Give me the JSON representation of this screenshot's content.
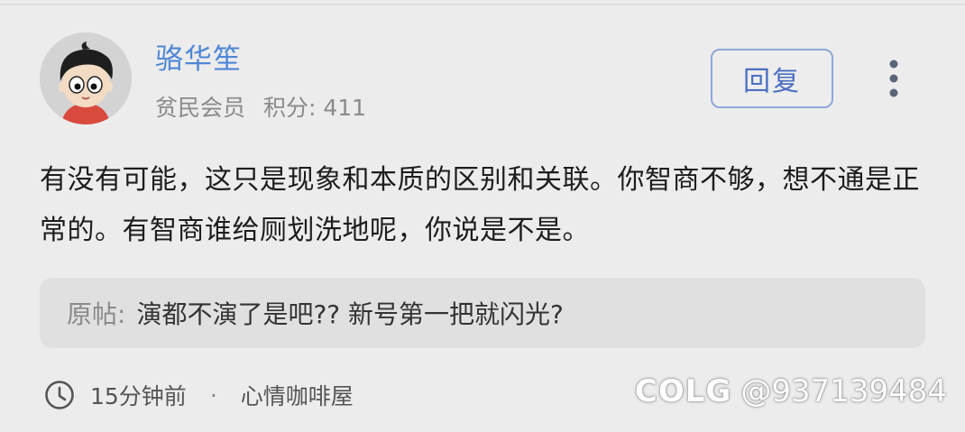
{
  "user": {
    "name": "骆华笙",
    "rank": "贫民会员",
    "points_label": "积分: 411"
  },
  "actions": {
    "reply_label": "回复",
    "more_icon": "more-vertical-icon"
  },
  "comment": {
    "text": "有没有可能，这只是现象和本质的区别和关联。你智商不够，想不通是正常的。有智商谁给厕划洗地呢，你说是不是。"
  },
  "quote": {
    "label": "原帖:",
    "text": "演都不演了是吧?? 新号第一把就闪光?"
  },
  "footer": {
    "time": "15分钟前",
    "separator": "·",
    "forum": "心情咖啡屋"
  },
  "watermark": {
    "logo": "COLG",
    "handle": "@937139484"
  },
  "colors": {
    "background": "#ececec",
    "username": "#4f86d6",
    "reply_border": "#8fa6d8",
    "reply_text": "#4b6fc3",
    "quote_bg": "#e0e0e0"
  }
}
